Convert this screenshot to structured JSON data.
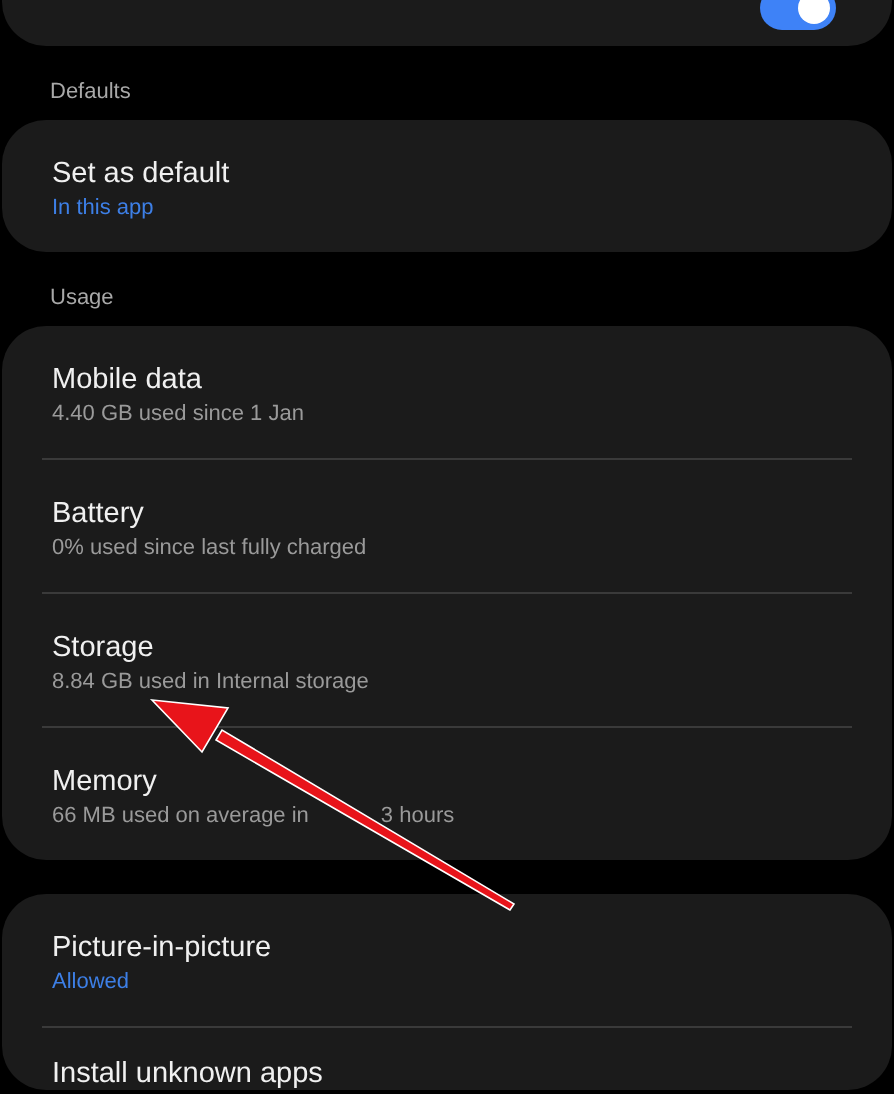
{
  "top_card": {
    "toggle": {
      "on": true
    }
  },
  "sections": [
    {
      "header": "Defaults",
      "items": [
        {
          "title": "Set as default",
          "subtitle": "In this app",
          "kind": "accent"
        }
      ]
    },
    {
      "header": "Usage",
      "items": [
        {
          "title": "Mobile data",
          "subtitle": "4.40 GB used since 1 Jan",
          "kind": "plain"
        },
        {
          "title": "Battery",
          "subtitle": "0% used since last fully charged",
          "kind": "plain"
        },
        {
          "title": "Storage",
          "subtitle": "8.84 GB used in Internal storage",
          "kind": "plain"
        },
        {
          "title": "Memory",
          "subtitle": "66 MB used on average in",
          "subtitle_after": "3 hours",
          "kind": "plain"
        }
      ]
    },
    {
      "items": [
        {
          "title": "Picture-in-picture",
          "subtitle": "Allowed",
          "kind": "accent"
        },
        {
          "title": "Install unknown apps",
          "kind": "plain"
        }
      ]
    }
  ]
}
